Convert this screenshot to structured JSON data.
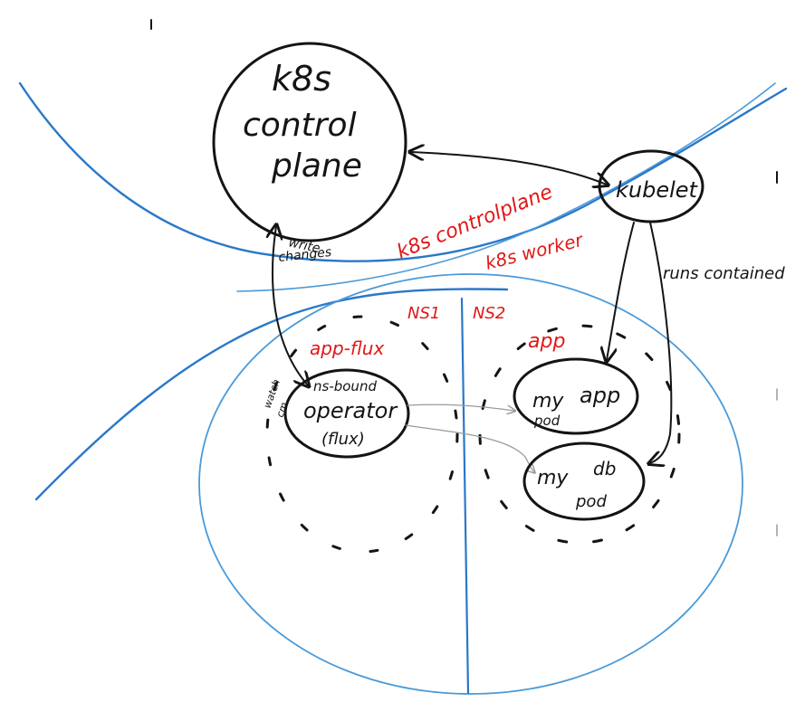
{
  "nodes": {
    "control_plane": [
      "k8s",
      "control",
      "plane"
    ],
    "kubelet": "kubelet",
    "operator": [
      "ns-bound",
      "operator",
      "(flux)"
    ],
    "my_app_pod": [
      "my",
      "pod",
      "app"
    ],
    "my_db_pod": [
      "my",
      "pod",
      "db"
    ]
  },
  "labels": {
    "write_changes": [
      "write",
      "changes"
    ],
    "boundary_control": "k8s controlplane",
    "boundary_worker": "k8s worker",
    "runs_contained": "runs contained",
    "ns1": "NS1",
    "ns2": "NS2",
    "ns1_name": "app-flux",
    "ns2_name": "app",
    "watch_cm": [
      "watch",
      "cm"
    ]
  },
  "colors": {
    "ink_black": "#141414",
    "ink_red": "#e01818",
    "ink_blue": "#2a78c8"
  }
}
